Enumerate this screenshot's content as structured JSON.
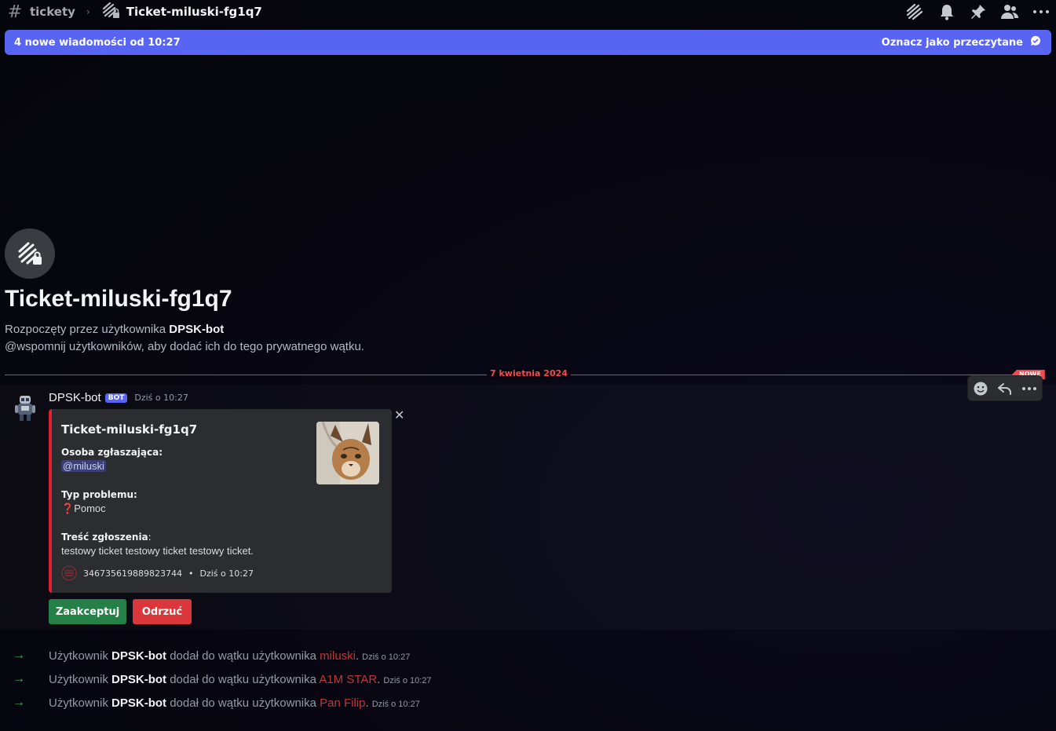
{
  "header": {
    "parent_channel": "tickety",
    "thread_title": "Ticket-miluski-fg1q7",
    "icons": [
      "threads-icon",
      "bell-icon",
      "pin-icon",
      "members-icon",
      "more-icon"
    ]
  },
  "banner": {
    "new_messages": "4 nowe wiadomości od 10:27",
    "mark_read": "Oznacz jako przeczytane"
  },
  "thread_intro": {
    "title": "Ticket-miluski-fg1q7",
    "started_by_prefix": "Rozpoczęty przez użytkownika ",
    "started_by_user": "DPSK-bot",
    "mention_hint": "@wspomnij użytkowników, aby dodać ich do tego prywatnego wątku."
  },
  "divider": {
    "date": "7 kwietnia 2024",
    "new_label": "NOWE"
  },
  "message": {
    "author": "DPSK-bot",
    "bot_tag": "BOT",
    "timestamp": "Dziś o 10:27",
    "embed": {
      "color": "#e0202c",
      "title": "Ticket-miluski-fg1q7",
      "fields": [
        {
          "name": "Osoba zgłaszająca:",
          "value": "@miluski"
        },
        {
          "name": "Typ problemu:",
          "emoji": "❓",
          "value": "Pomoc"
        },
        {
          "name": "Treść zgłoszenia",
          "suffix": ":",
          "value": "testowy ticket testowy ticket testowy ticket."
        }
      ],
      "footer_id": "346735619889823744",
      "footer_sep": "•",
      "footer_time": "Dziś o 10:27"
    },
    "buttons": {
      "accept": "Zaakceptuj",
      "reject": "Odrzuć"
    }
  },
  "system_messages": [
    {
      "prefix": "Użytkownik ",
      "actor": "DPSK-bot",
      "middle": " dodał do wątku użytkownika ",
      "target": "miluski",
      "end": ".",
      "time": "Dziś o 10:27"
    },
    {
      "prefix": "Użytkownik ",
      "actor": "DPSK-bot",
      "middle": " dodał do wątku użytkownika ",
      "target": "A1M STAR",
      "end": ".",
      "time": "Dziś o 10:27"
    },
    {
      "prefix": "Użytkownik ",
      "actor": "DPSK-bot",
      "middle": " dodał do wątku użytkownika ",
      "target": "Pan Filip",
      "end": ".",
      "time": "Dziś o 10:27"
    }
  ],
  "colors": {
    "accent": "#5865f2",
    "divider": "#d83a42",
    "accept": "#248046",
    "reject": "#da373c",
    "join_arrow": "#3ba55d",
    "username_red": "#c03636"
  }
}
